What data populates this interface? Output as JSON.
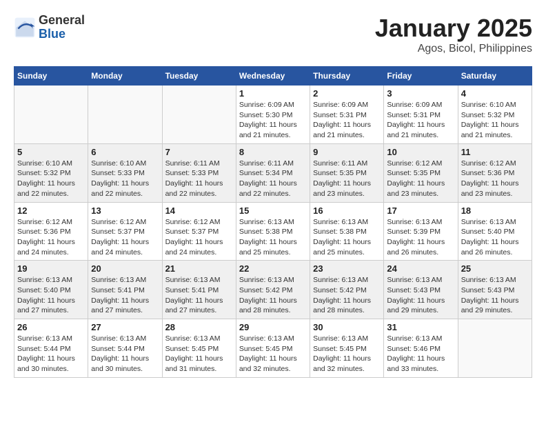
{
  "logo": {
    "general": "General",
    "blue": "Blue"
  },
  "title": "January 2025",
  "subtitle": "Agos, Bicol, Philippines",
  "days_of_week": [
    "Sunday",
    "Monday",
    "Tuesday",
    "Wednesday",
    "Thursday",
    "Friday",
    "Saturday"
  ],
  "weeks": [
    [
      {
        "day": "",
        "info": ""
      },
      {
        "day": "",
        "info": ""
      },
      {
        "day": "",
        "info": ""
      },
      {
        "day": "1",
        "info": "Sunrise: 6:09 AM\nSunset: 5:30 PM\nDaylight: 11 hours and 21 minutes."
      },
      {
        "day": "2",
        "info": "Sunrise: 6:09 AM\nSunset: 5:31 PM\nDaylight: 11 hours and 21 minutes."
      },
      {
        "day": "3",
        "info": "Sunrise: 6:09 AM\nSunset: 5:31 PM\nDaylight: 11 hours and 21 minutes."
      },
      {
        "day": "4",
        "info": "Sunrise: 6:10 AM\nSunset: 5:32 PM\nDaylight: 11 hours and 21 minutes."
      }
    ],
    [
      {
        "day": "5",
        "info": "Sunrise: 6:10 AM\nSunset: 5:32 PM\nDaylight: 11 hours and 22 minutes."
      },
      {
        "day": "6",
        "info": "Sunrise: 6:10 AM\nSunset: 5:33 PM\nDaylight: 11 hours and 22 minutes."
      },
      {
        "day": "7",
        "info": "Sunrise: 6:11 AM\nSunset: 5:33 PM\nDaylight: 11 hours and 22 minutes."
      },
      {
        "day": "8",
        "info": "Sunrise: 6:11 AM\nSunset: 5:34 PM\nDaylight: 11 hours and 22 minutes."
      },
      {
        "day": "9",
        "info": "Sunrise: 6:11 AM\nSunset: 5:35 PM\nDaylight: 11 hours and 23 minutes."
      },
      {
        "day": "10",
        "info": "Sunrise: 6:12 AM\nSunset: 5:35 PM\nDaylight: 11 hours and 23 minutes."
      },
      {
        "day": "11",
        "info": "Sunrise: 6:12 AM\nSunset: 5:36 PM\nDaylight: 11 hours and 23 minutes."
      }
    ],
    [
      {
        "day": "12",
        "info": "Sunrise: 6:12 AM\nSunset: 5:36 PM\nDaylight: 11 hours and 24 minutes."
      },
      {
        "day": "13",
        "info": "Sunrise: 6:12 AM\nSunset: 5:37 PM\nDaylight: 11 hours and 24 minutes."
      },
      {
        "day": "14",
        "info": "Sunrise: 6:12 AM\nSunset: 5:37 PM\nDaylight: 11 hours and 24 minutes."
      },
      {
        "day": "15",
        "info": "Sunrise: 6:13 AM\nSunset: 5:38 PM\nDaylight: 11 hours and 25 minutes."
      },
      {
        "day": "16",
        "info": "Sunrise: 6:13 AM\nSunset: 5:38 PM\nDaylight: 11 hours and 25 minutes."
      },
      {
        "day": "17",
        "info": "Sunrise: 6:13 AM\nSunset: 5:39 PM\nDaylight: 11 hours and 26 minutes."
      },
      {
        "day": "18",
        "info": "Sunrise: 6:13 AM\nSunset: 5:40 PM\nDaylight: 11 hours and 26 minutes."
      }
    ],
    [
      {
        "day": "19",
        "info": "Sunrise: 6:13 AM\nSunset: 5:40 PM\nDaylight: 11 hours and 27 minutes."
      },
      {
        "day": "20",
        "info": "Sunrise: 6:13 AM\nSunset: 5:41 PM\nDaylight: 11 hours and 27 minutes."
      },
      {
        "day": "21",
        "info": "Sunrise: 6:13 AM\nSunset: 5:41 PM\nDaylight: 11 hours and 27 minutes."
      },
      {
        "day": "22",
        "info": "Sunrise: 6:13 AM\nSunset: 5:42 PM\nDaylight: 11 hours and 28 minutes."
      },
      {
        "day": "23",
        "info": "Sunrise: 6:13 AM\nSunset: 5:42 PM\nDaylight: 11 hours and 28 minutes."
      },
      {
        "day": "24",
        "info": "Sunrise: 6:13 AM\nSunset: 5:43 PM\nDaylight: 11 hours and 29 minutes."
      },
      {
        "day": "25",
        "info": "Sunrise: 6:13 AM\nSunset: 5:43 PM\nDaylight: 11 hours and 29 minutes."
      }
    ],
    [
      {
        "day": "26",
        "info": "Sunrise: 6:13 AM\nSunset: 5:44 PM\nDaylight: 11 hours and 30 minutes."
      },
      {
        "day": "27",
        "info": "Sunrise: 6:13 AM\nSunset: 5:44 PM\nDaylight: 11 hours and 30 minutes."
      },
      {
        "day": "28",
        "info": "Sunrise: 6:13 AM\nSunset: 5:45 PM\nDaylight: 11 hours and 31 minutes."
      },
      {
        "day": "29",
        "info": "Sunrise: 6:13 AM\nSunset: 5:45 PM\nDaylight: 11 hours and 32 minutes."
      },
      {
        "day": "30",
        "info": "Sunrise: 6:13 AM\nSunset: 5:45 PM\nDaylight: 11 hours and 32 minutes."
      },
      {
        "day": "31",
        "info": "Sunrise: 6:13 AM\nSunset: 5:46 PM\nDaylight: 11 hours and 33 minutes."
      },
      {
        "day": "",
        "info": ""
      }
    ]
  ]
}
